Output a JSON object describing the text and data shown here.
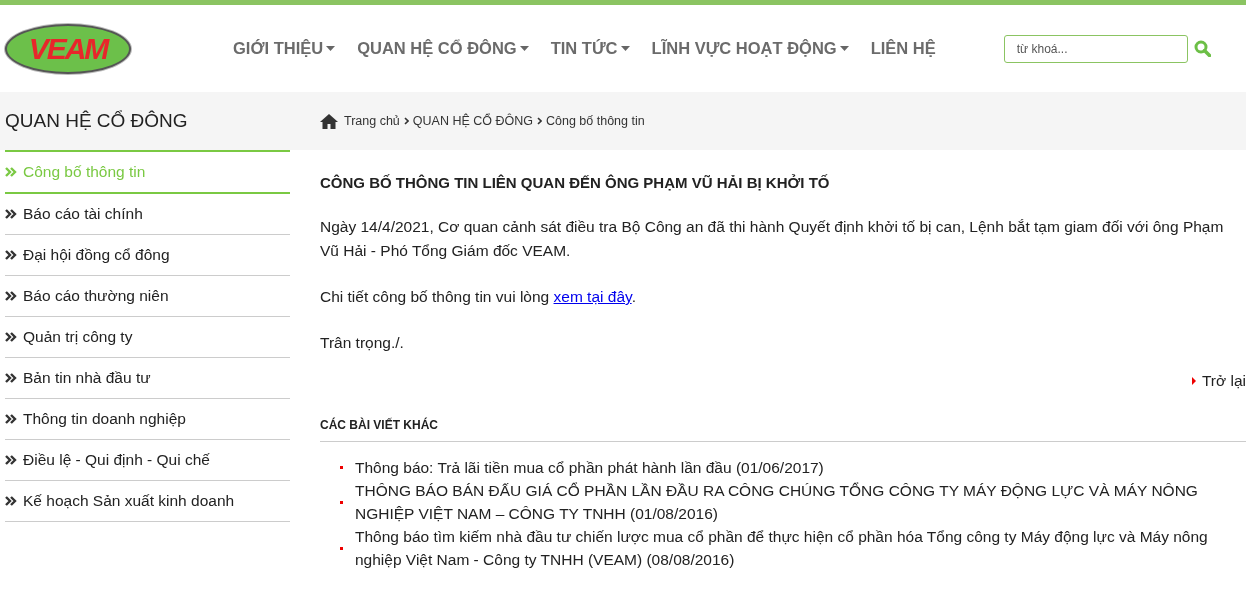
{
  "logo": {
    "text": "VEAM"
  },
  "nav": [
    {
      "label": "GIỚI THIỆU",
      "dropdown": true
    },
    {
      "label": "QUAN HỆ CỔ ĐÔNG",
      "dropdown": true
    },
    {
      "label": "TIN TỨC",
      "dropdown": true
    },
    {
      "label": "LĨNH VỰC HOẠT ĐỘNG",
      "dropdown": true
    },
    {
      "label": "LIÊN HỆ",
      "dropdown": false
    }
  ],
  "search": {
    "placeholder": "từ khoá..."
  },
  "sidebar": {
    "title": "QUAN HỆ CỔ ĐÔNG",
    "items": [
      {
        "label": "Công bố thông tin",
        "selected": true
      },
      {
        "label": "Báo cáo tài chính",
        "selected": false
      },
      {
        "label": "Đại hội đồng cổ đông",
        "selected": false
      },
      {
        "label": "Báo cáo thường niên",
        "selected": false
      },
      {
        "label": "Quản trị công ty",
        "selected": false
      },
      {
        "label": "Bản tin nhà đầu tư",
        "selected": false
      },
      {
        "label": "Thông tin doanh nghiệp",
        "selected": false
      },
      {
        "label": "Điều lệ - Qui định - Qui chế",
        "selected": false
      },
      {
        "label": "Kế hoạch Sản xuất kinh doanh",
        "selected": false
      }
    ]
  },
  "breadcrumb": [
    {
      "label": "Trang chủ",
      "kind": "home"
    },
    {
      "label": "QUAN HỆ CỔ ĐÔNG",
      "kind": "crumb"
    },
    {
      "label": "Công bố thông tin",
      "kind": "crumb"
    }
  ],
  "article": {
    "title": "CÔNG BỐ THÔNG TIN LIÊN QUAN ĐẾN ÔNG PHẠM VŨ HẢI BỊ KHỞI TỐ",
    "paragraph": "Ngày 14/4/2021, Cơ quan cảnh sát điều tra Bộ Công an đã thi hành Quyết định khởi tố bị can, Lệnh bắt tạm giam đối với ông Phạm Vũ Hải - Phó Tổng Giám đốc VEAM.",
    "detail_text": "Chi tiết công bố thông tin vui lòng",
    "detail_link": "xem tại đây",
    "detail_end": ".",
    "closing": "Trân trọng./.",
    "back": "Trở lại"
  },
  "related": {
    "title": "CÁC BÀI VIẾT KHÁC",
    "items": [
      "Thông báo: Trả lãi tiền mua cổ phần phát hành lần đầu (01/06/2017)",
      "THÔNG BÁO BÁN ĐẤU GIÁ CỔ PHẦN LẦN ĐẦU RA CÔNG CHÚNG TỔNG CÔNG TY MÁY ĐỘNG LỰC VÀ MÁY NÔNG NGHIỆP VIỆT NAM – CÔNG TY TNHH (01/08/2016)",
      "Thông báo tìm kiếm nhà đầu tư chiến lược mua cổ phần để thực hiện cổ phần hóa Tổng công ty Máy động lực và Máy nông nghiệp Việt Nam - Công ty TNHH (VEAM) (08/08/2016)"
    ]
  }
}
